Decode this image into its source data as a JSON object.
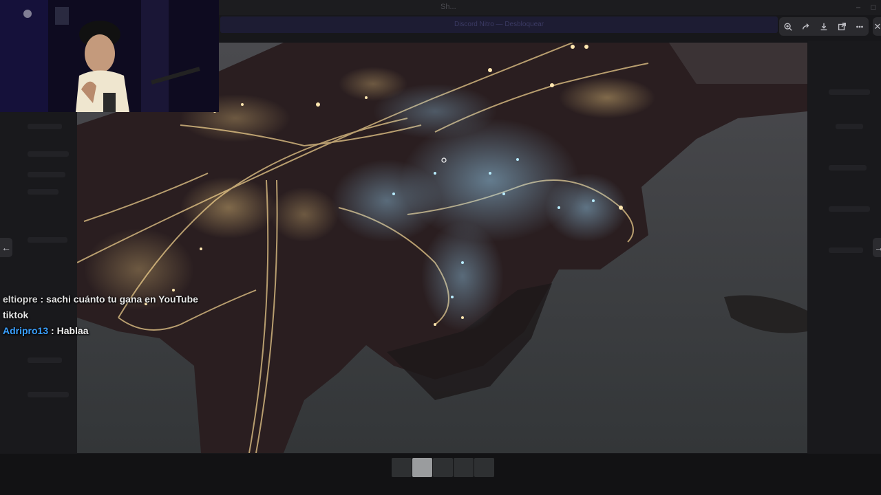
{
  "app": {
    "title": "Sh..."
  },
  "banner": {
    "text": "Discord Nitro — Desbloquear"
  },
  "toolbar": {
    "buttons": [
      {
        "icon": "zoom-in-icon",
        "label": "Zoom"
      },
      {
        "icon": "forward-icon",
        "label": "Forward"
      },
      {
        "icon": "download-icon",
        "label": "Download"
      },
      {
        "icon": "open-external-icon",
        "label": "Open in browser"
      },
      {
        "icon": "more-icon",
        "label": "More"
      }
    ],
    "close_glyph": "✕"
  },
  "navigation": {
    "prev_glyph": "←",
    "next_glyph": "→"
  },
  "chat": {
    "messages": [
      {
        "user": "eltiopre",
        "separator": " : ",
        "text": "sachi cuánto tu gana en YouTube tiktok"
      },
      {
        "user": "Adripro13",
        "separator": " : ",
        "text": "Hablaa"
      }
    ],
    "colors": {
      "user1": "#d8d8d8",
      "user2": "#3aa0ff"
    }
  },
  "thumbnails": {
    "count": 5,
    "active_index": 1
  },
  "colors": {
    "background": "#141416",
    "toolbar": "#2a2a2e",
    "water": "#3a3c3e",
    "land": "#2a1e20",
    "city_lights_warm": "#f3d27a",
    "city_lights_cool": "#8fd3ff"
  }
}
